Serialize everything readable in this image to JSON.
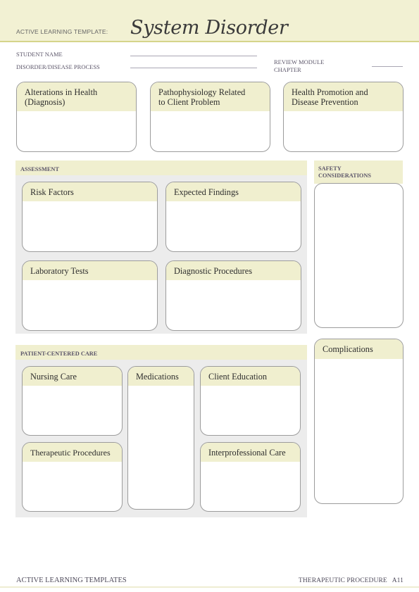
{
  "header": {
    "template_label": "ACTIVE LEARNING TEMPLATE:",
    "title": "System Disorder"
  },
  "fields": {
    "student_name": {
      "label": "STUDENT NAME",
      "value": ""
    },
    "disorder_process": {
      "label": "DISORDER/DISEASE PROCESS",
      "value": ""
    },
    "review_module": {
      "label_line1": "REVIEW MODULE",
      "label_line2": "CHAPTER",
      "value": ""
    }
  },
  "top_boxes": [
    {
      "label_line1": "Alterations in Health",
      "label_line2": "(Diagnosis)",
      "value": ""
    },
    {
      "label_line1": "Pathophysiology Related",
      "label_line2": "to Client Problem",
      "value": ""
    },
    {
      "label_line1": "Health Promotion and",
      "label_line2": "Disease Prevention",
      "value": ""
    }
  ],
  "assessment": {
    "heading": "ASSESSMENT",
    "boxes": [
      {
        "label": "Risk Factors",
        "value": ""
      },
      {
        "label": "Expected Findings",
        "value": ""
      },
      {
        "label": "Laboratory Tests",
        "value": ""
      },
      {
        "label": "Diagnostic Procedures",
        "value": ""
      }
    ]
  },
  "safety": {
    "heading_line1": "SAFETY",
    "heading_line2": "CONSIDERATIONS",
    "value": ""
  },
  "patient_care": {
    "heading": "PATIENT-CENTERED CARE",
    "boxes": [
      {
        "label": "Nursing Care",
        "value": ""
      },
      {
        "label": "Medications",
        "value": ""
      },
      {
        "label": "Client Education",
        "value": ""
      },
      {
        "label": "Therapeutic Procedures",
        "value": ""
      },
      {
        "label": "Interprofessional Care",
        "value": ""
      }
    ]
  },
  "complications": {
    "label": "Complications",
    "value": ""
  },
  "footer": {
    "left": "ACTIVE LEARNING TEMPLATES",
    "right": "THERAPEUTIC PROCEDURE   A11"
  }
}
